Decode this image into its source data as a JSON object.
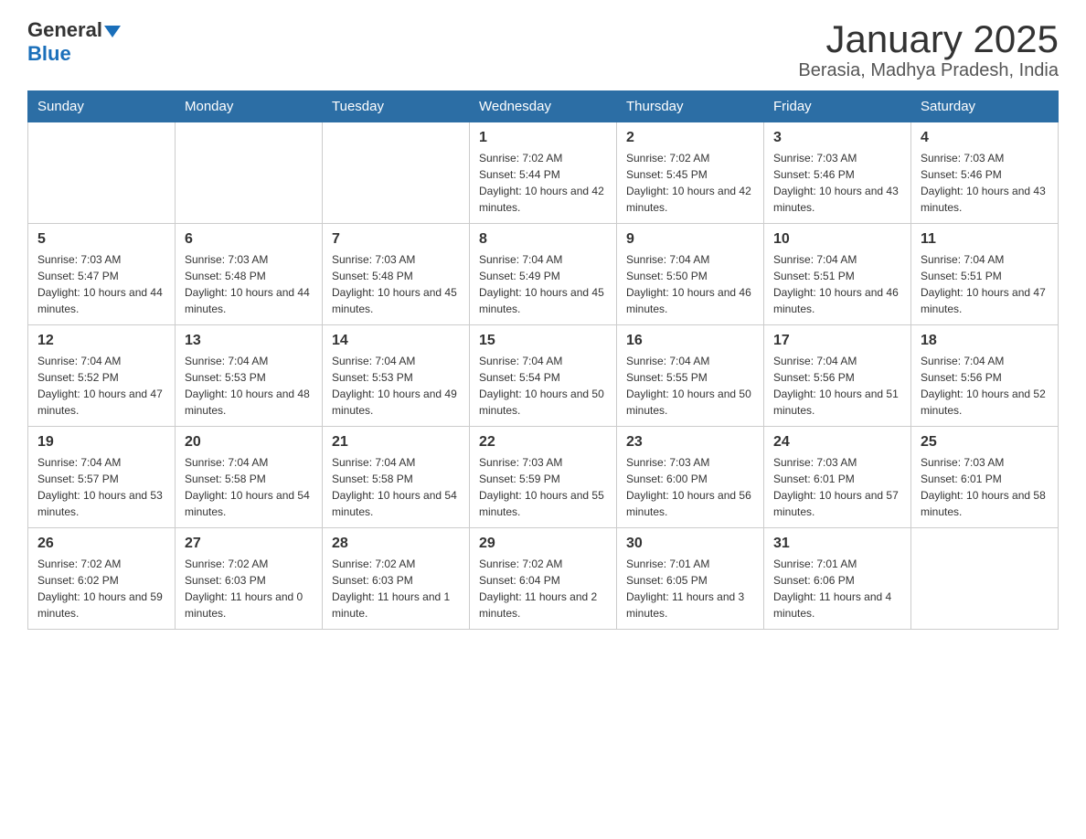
{
  "header": {
    "logo": {
      "general": "General",
      "blue": "Blue"
    },
    "title": "January 2025",
    "subtitle": "Berasia, Madhya Pradesh, India"
  },
  "calendar": {
    "days_of_week": [
      "Sunday",
      "Monday",
      "Tuesday",
      "Wednesday",
      "Thursday",
      "Friday",
      "Saturday"
    ],
    "weeks": [
      [
        {
          "day": "",
          "info": ""
        },
        {
          "day": "",
          "info": ""
        },
        {
          "day": "",
          "info": ""
        },
        {
          "day": "1",
          "info": "Sunrise: 7:02 AM\nSunset: 5:44 PM\nDaylight: 10 hours and 42 minutes."
        },
        {
          "day": "2",
          "info": "Sunrise: 7:02 AM\nSunset: 5:45 PM\nDaylight: 10 hours and 42 minutes."
        },
        {
          "day": "3",
          "info": "Sunrise: 7:03 AM\nSunset: 5:46 PM\nDaylight: 10 hours and 43 minutes."
        },
        {
          "day": "4",
          "info": "Sunrise: 7:03 AM\nSunset: 5:46 PM\nDaylight: 10 hours and 43 minutes."
        }
      ],
      [
        {
          "day": "5",
          "info": "Sunrise: 7:03 AM\nSunset: 5:47 PM\nDaylight: 10 hours and 44 minutes."
        },
        {
          "day": "6",
          "info": "Sunrise: 7:03 AM\nSunset: 5:48 PM\nDaylight: 10 hours and 44 minutes."
        },
        {
          "day": "7",
          "info": "Sunrise: 7:03 AM\nSunset: 5:48 PM\nDaylight: 10 hours and 45 minutes."
        },
        {
          "day": "8",
          "info": "Sunrise: 7:04 AM\nSunset: 5:49 PM\nDaylight: 10 hours and 45 minutes."
        },
        {
          "day": "9",
          "info": "Sunrise: 7:04 AM\nSunset: 5:50 PM\nDaylight: 10 hours and 46 minutes."
        },
        {
          "day": "10",
          "info": "Sunrise: 7:04 AM\nSunset: 5:51 PM\nDaylight: 10 hours and 46 minutes."
        },
        {
          "day": "11",
          "info": "Sunrise: 7:04 AM\nSunset: 5:51 PM\nDaylight: 10 hours and 47 minutes."
        }
      ],
      [
        {
          "day": "12",
          "info": "Sunrise: 7:04 AM\nSunset: 5:52 PM\nDaylight: 10 hours and 47 minutes."
        },
        {
          "day": "13",
          "info": "Sunrise: 7:04 AM\nSunset: 5:53 PM\nDaylight: 10 hours and 48 minutes."
        },
        {
          "day": "14",
          "info": "Sunrise: 7:04 AM\nSunset: 5:53 PM\nDaylight: 10 hours and 49 minutes."
        },
        {
          "day": "15",
          "info": "Sunrise: 7:04 AM\nSunset: 5:54 PM\nDaylight: 10 hours and 50 minutes."
        },
        {
          "day": "16",
          "info": "Sunrise: 7:04 AM\nSunset: 5:55 PM\nDaylight: 10 hours and 50 minutes."
        },
        {
          "day": "17",
          "info": "Sunrise: 7:04 AM\nSunset: 5:56 PM\nDaylight: 10 hours and 51 minutes."
        },
        {
          "day": "18",
          "info": "Sunrise: 7:04 AM\nSunset: 5:56 PM\nDaylight: 10 hours and 52 minutes."
        }
      ],
      [
        {
          "day": "19",
          "info": "Sunrise: 7:04 AM\nSunset: 5:57 PM\nDaylight: 10 hours and 53 minutes."
        },
        {
          "day": "20",
          "info": "Sunrise: 7:04 AM\nSunset: 5:58 PM\nDaylight: 10 hours and 54 minutes."
        },
        {
          "day": "21",
          "info": "Sunrise: 7:04 AM\nSunset: 5:58 PM\nDaylight: 10 hours and 54 minutes."
        },
        {
          "day": "22",
          "info": "Sunrise: 7:03 AM\nSunset: 5:59 PM\nDaylight: 10 hours and 55 minutes."
        },
        {
          "day": "23",
          "info": "Sunrise: 7:03 AM\nSunset: 6:00 PM\nDaylight: 10 hours and 56 minutes."
        },
        {
          "day": "24",
          "info": "Sunrise: 7:03 AM\nSunset: 6:01 PM\nDaylight: 10 hours and 57 minutes."
        },
        {
          "day": "25",
          "info": "Sunrise: 7:03 AM\nSunset: 6:01 PM\nDaylight: 10 hours and 58 minutes."
        }
      ],
      [
        {
          "day": "26",
          "info": "Sunrise: 7:02 AM\nSunset: 6:02 PM\nDaylight: 10 hours and 59 minutes."
        },
        {
          "day": "27",
          "info": "Sunrise: 7:02 AM\nSunset: 6:03 PM\nDaylight: 11 hours and 0 minutes."
        },
        {
          "day": "28",
          "info": "Sunrise: 7:02 AM\nSunset: 6:03 PM\nDaylight: 11 hours and 1 minute."
        },
        {
          "day": "29",
          "info": "Sunrise: 7:02 AM\nSunset: 6:04 PM\nDaylight: 11 hours and 2 minutes."
        },
        {
          "day": "30",
          "info": "Sunrise: 7:01 AM\nSunset: 6:05 PM\nDaylight: 11 hours and 3 minutes."
        },
        {
          "day": "31",
          "info": "Sunrise: 7:01 AM\nSunset: 6:06 PM\nDaylight: 11 hours and 4 minutes."
        },
        {
          "day": "",
          "info": ""
        }
      ]
    ]
  }
}
